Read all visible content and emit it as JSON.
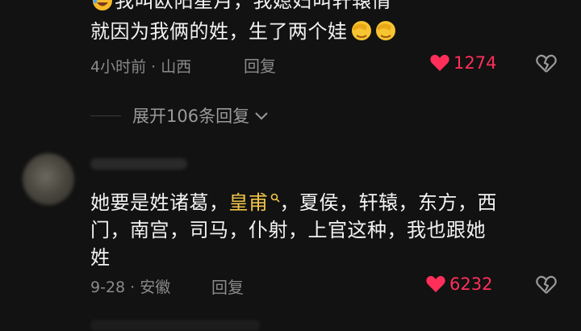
{
  "comment1": {
    "line1": "我叫欧阳星月，我媳妇叫轩辕情",
    "line2": "就因为我俩的姓，生了两个娃",
    "time_location": "4小时前 · 山西",
    "reply_label": "回复",
    "likes": "1274",
    "emojis": [
      "facepalm-emoji",
      "facepalm-emoji"
    ]
  },
  "expand": {
    "label": "展开106条回复"
  },
  "comment2": {
    "text_before": "她要是姓诸葛，",
    "highlight": "皇甫",
    "text_after_line1": "，夏侯，轩辕，东方，西",
    "line2": "门，南宫，司马，仆射，上官这种，我也跟她",
    "line3": "姓",
    "time_location": "9-28 · 安徽",
    "reply_label": "回复",
    "likes": "6232"
  },
  "colors": {
    "like": "#ff2f5a",
    "highlight": "#f0c44a",
    "background": "#121212"
  }
}
